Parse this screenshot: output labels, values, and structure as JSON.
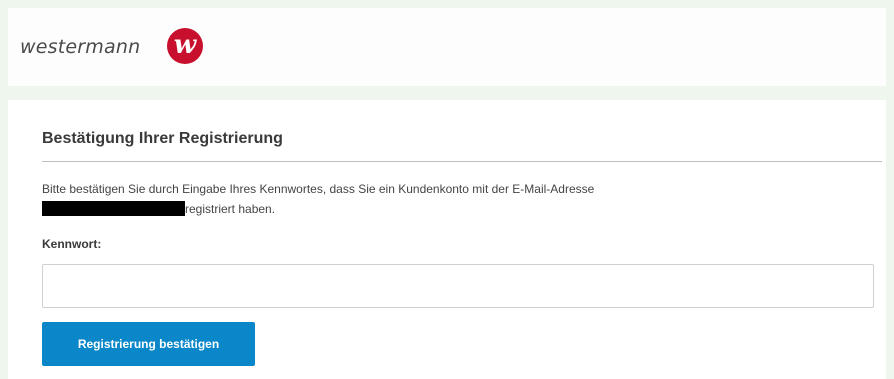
{
  "header": {
    "brand_text": "westermann",
    "logo_letter": "w",
    "logo_color": "#c8102e"
  },
  "card": {
    "title": "Bestätigung Ihrer Registrierung",
    "info_text_before": "Bitte bestätigen Sie durch Eingabe Ihres Kennwortes, dass Sie ein Kundenkonto mit der E-Mail-Adresse",
    "info_text_after": "registriert haben.",
    "password_label": "Kennwort:",
    "password_value": "",
    "submit_label": "Registrierung bestätigen",
    "button_color": "#0a87c9"
  }
}
